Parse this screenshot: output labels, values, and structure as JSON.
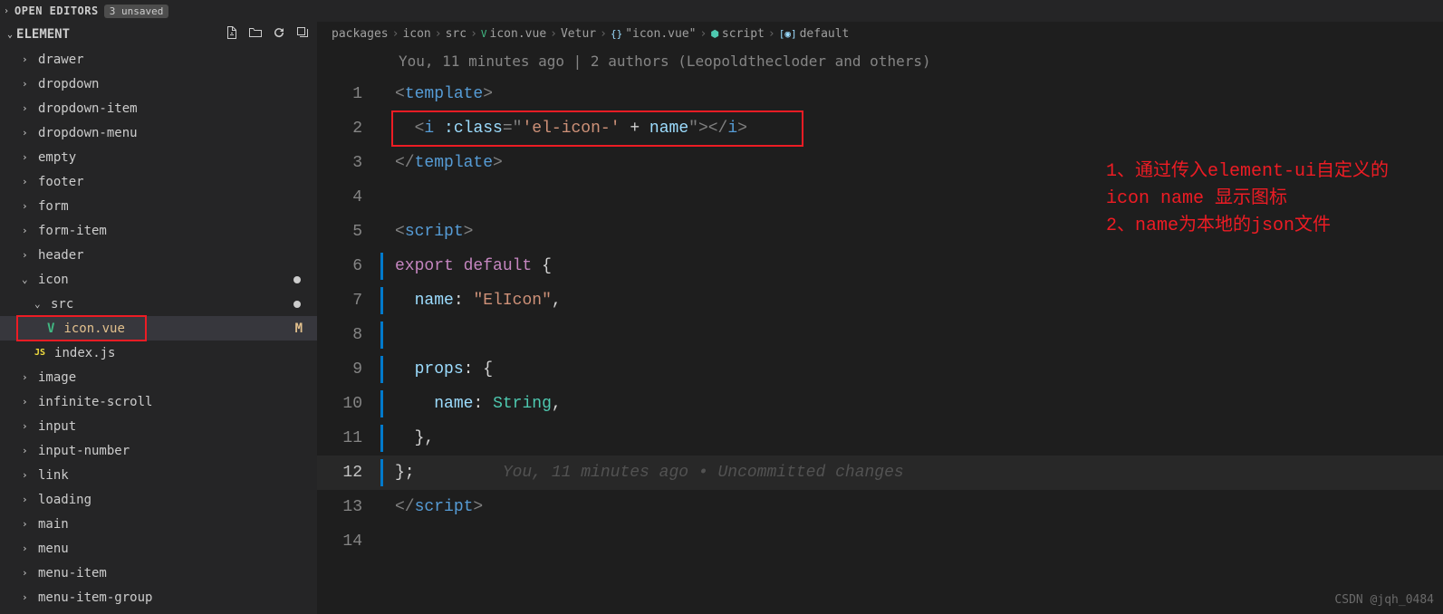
{
  "topbar": {
    "open_editors_label": "OPEN EDITORS",
    "unsaved_badge": "3 unsaved"
  },
  "sidebar": {
    "title": "ELEMENT",
    "items": [
      {
        "label": "drawer",
        "indent": 0,
        "expanded": false
      },
      {
        "label": "dropdown",
        "indent": 0,
        "expanded": false
      },
      {
        "label": "dropdown-item",
        "indent": 0,
        "expanded": false
      },
      {
        "label": "dropdown-menu",
        "indent": 0,
        "expanded": false
      },
      {
        "label": "empty",
        "indent": 0,
        "expanded": false
      },
      {
        "label": "footer",
        "indent": 0,
        "expanded": false
      },
      {
        "label": "form",
        "indent": 0,
        "expanded": false
      },
      {
        "label": "form-item",
        "indent": 0,
        "expanded": false
      },
      {
        "label": "header",
        "indent": 0,
        "expanded": false
      },
      {
        "label": "icon",
        "indent": 0,
        "expanded": true,
        "dot": true
      },
      {
        "label": "src",
        "indent": 1,
        "expanded": true,
        "dot": true
      },
      {
        "label": "icon.vue",
        "indent": 2,
        "file": "vue",
        "selected": true,
        "modified": "M",
        "redbox": true
      },
      {
        "label": "index.js",
        "indent": 1,
        "file": "js"
      },
      {
        "label": "image",
        "indent": 0,
        "expanded": false
      },
      {
        "label": "infinite-scroll",
        "indent": 0,
        "expanded": false
      },
      {
        "label": "input",
        "indent": 0,
        "expanded": false
      },
      {
        "label": "input-number",
        "indent": 0,
        "expanded": false
      },
      {
        "label": "link",
        "indent": 0,
        "expanded": false
      },
      {
        "label": "loading",
        "indent": 0,
        "expanded": false
      },
      {
        "label": "main",
        "indent": 0,
        "expanded": false
      },
      {
        "label": "menu",
        "indent": 0,
        "expanded": false
      },
      {
        "label": "menu-item",
        "indent": 0,
        "expanded": false
      },
      {
        "label": "menu-item-group",
        "indent": 0,
        "expanded": false
      }
    ]
  },
  "breadcrumb": {
    "items": [
      "packages",
      "icon",
      "src",
      "icon.vue",
      "Vetur",
      "\"icon.vue\"",
      "script",
      "default"
    ]
  },
  "blame": "You, 11 minutes ago | 2 authors (Leopoldthecloder and others)",
  "code": {
    "lines": [
      {
        "n": 1,
        "type": "tag-open",
        "tag": "template"
      },
      {
        "n": 2,
        "type": "i-line"
      },
      {
        "n": 3,
        "type": "tag-close",
        "tag": "template"
      },
      {
        "n": 4,
        "type": "blank"
      },
      {
        "n": 5,
        "type": "tag-open",
        "tag": "script"
      },
      {
        "n": 6,
        "type": "export",
        "blue": true
      },
      {
        "n": 7,
        "type": "name",
        "value": "ElIcon",
        "blue": true
      },
      {
        "n": 8,
        "type": "blank",
        "blue": true
      },
      {
        "n": 9,
        "type": "props-open",
        "blue": true
      },
      {
        "n": 10,
        "type": "props-name",
        "blue": true
      },
      {
        "n": 11,
        "type": "props-close",
        "blue": true
      },
      {
        "n": 12,
        "type": "obj-close",
        "blue": true,
        "current": true,
        "ghost": "You, 11 minutes ago • Uncommitted changes"
      },
      {
        "n": 13,
        "type": "tag-close",
        "tag": "script"
      },
      {
        "n": 14,
        "type": "blank"
      }
    ],
    "i_line": {
      "attr": ":class",
      "str1": "'el-icon-'",
      "op": " + ",
      "var": "name"
    }
  },
  "annotations": {
    "line1": "1、通过传入element-ui自定义的",
    "line2": "icon name 显示图标",
    "line3": "2、name为本地的json文件"
  },
  "watermark": "CSDN @jqh_0484"
}
